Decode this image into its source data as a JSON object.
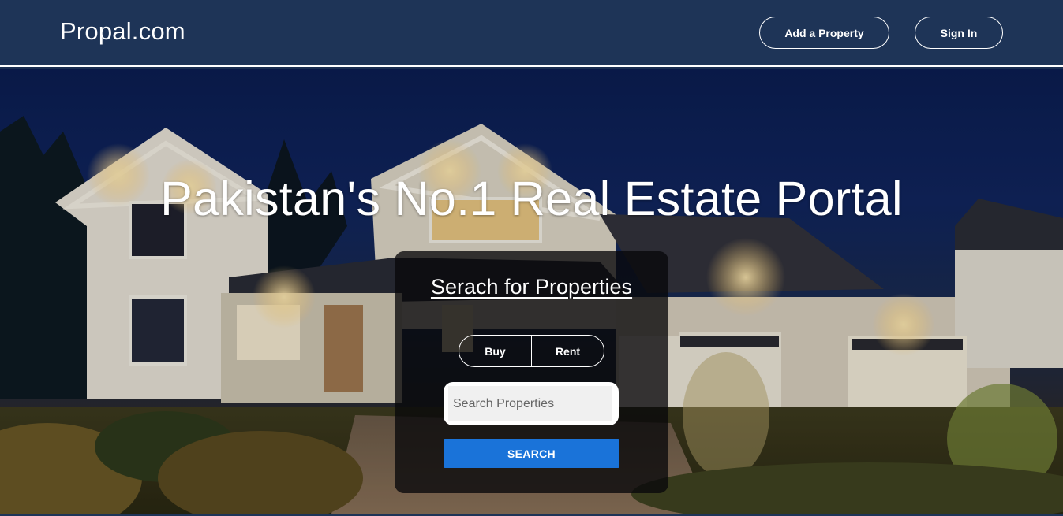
{
  "navbar": {
    "brand": "Propal.com",
    "add_property_label": "Add a Property",
    "sign_in_label": "Sign In",
    "background_color": "#1e3457"
  },
  "hero": {
    "title": "Pakistan's No.1 Real Estate Portal",
    "background_image": "house-at-night-photo"
  },
  "search_panel": {
    "title": "Serach for Properties",
    "toggle": [
      "Buy",
      "Rent"
    ],
    "search_placeholder": "Search Properties",
    "search_value": "",
    "search_button_label": "SEARCH",
    "button_color": "#1a73d9"
  }
}
